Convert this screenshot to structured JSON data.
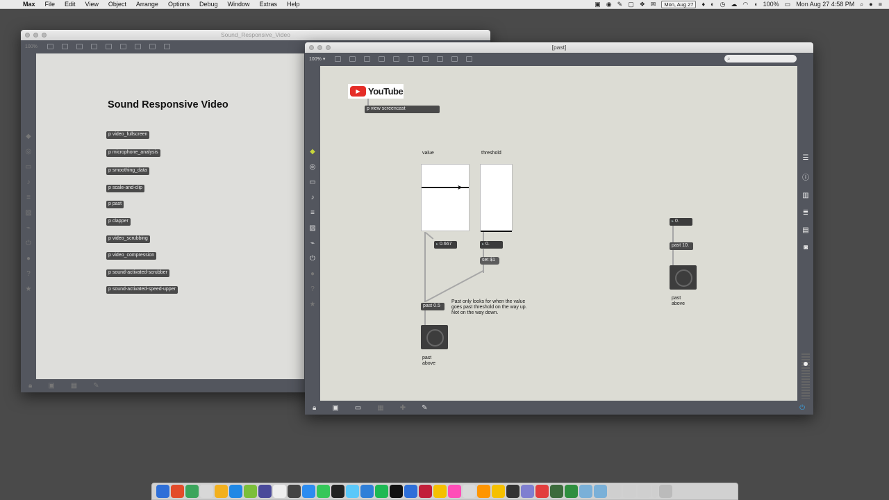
{
  "menubar": {
    "app_name": "Max",
    "items": [
      "File",
      "Edit",
      "View",
      "Object",
      "Arrange",
      "Options",
      "Debug",
      "Window",
      "Extras",
      "Help"
    ],
    "date_box": "Mon, Aug 27",
    "battery": "100%",
    "clock": "Mon Aug 27  4:58 PM"
  },
  "main_window": {
    "title": "Sound_Responsive_Video",
    "zoom": "100%",
    "heading": "Sound Responsive Video",
    "subpatchers": [
      "p video_fullscreen",
      "p microphone_analysis",
      "p smoothing_data",
      "p scale-and-clip",
      "p past",
      "p clapper",
      "p video_scrubbing",
      "p video_compression",
      "p sound-activated-scrubber",
      "p sound-activated-speed-upper"
    ]
  },
  "past_window": {
    "title": "[past]",
    "zoom": "100%",
    "youtube_label": "YouTube",
    "view_screencast": "p view screencast",
    "value_label": "value",
    "threshold_label": "threshold",
    "value_slider": 0.667,
    "threshold_slider": 0,
    "value_number": "0.667",
    "threshold_number": "0.",
    "set_message": "set $1",
    "past_object": "past 0.5",
    "comment": "Past only looks for when the value\ngoes past threshold on the way up.\nNot on the way down.",
    "button_label": "past\nabove",
    "right_number": "0.",
    "right_past_object": "past 10.",
    "right_button_label": "past\nabove"
  },
  "colors": {
    "canvas": "#dcdcd4",
    "window_chrome": "#53565e",
    "object_bg": "#4a4a4a"
  }
}
